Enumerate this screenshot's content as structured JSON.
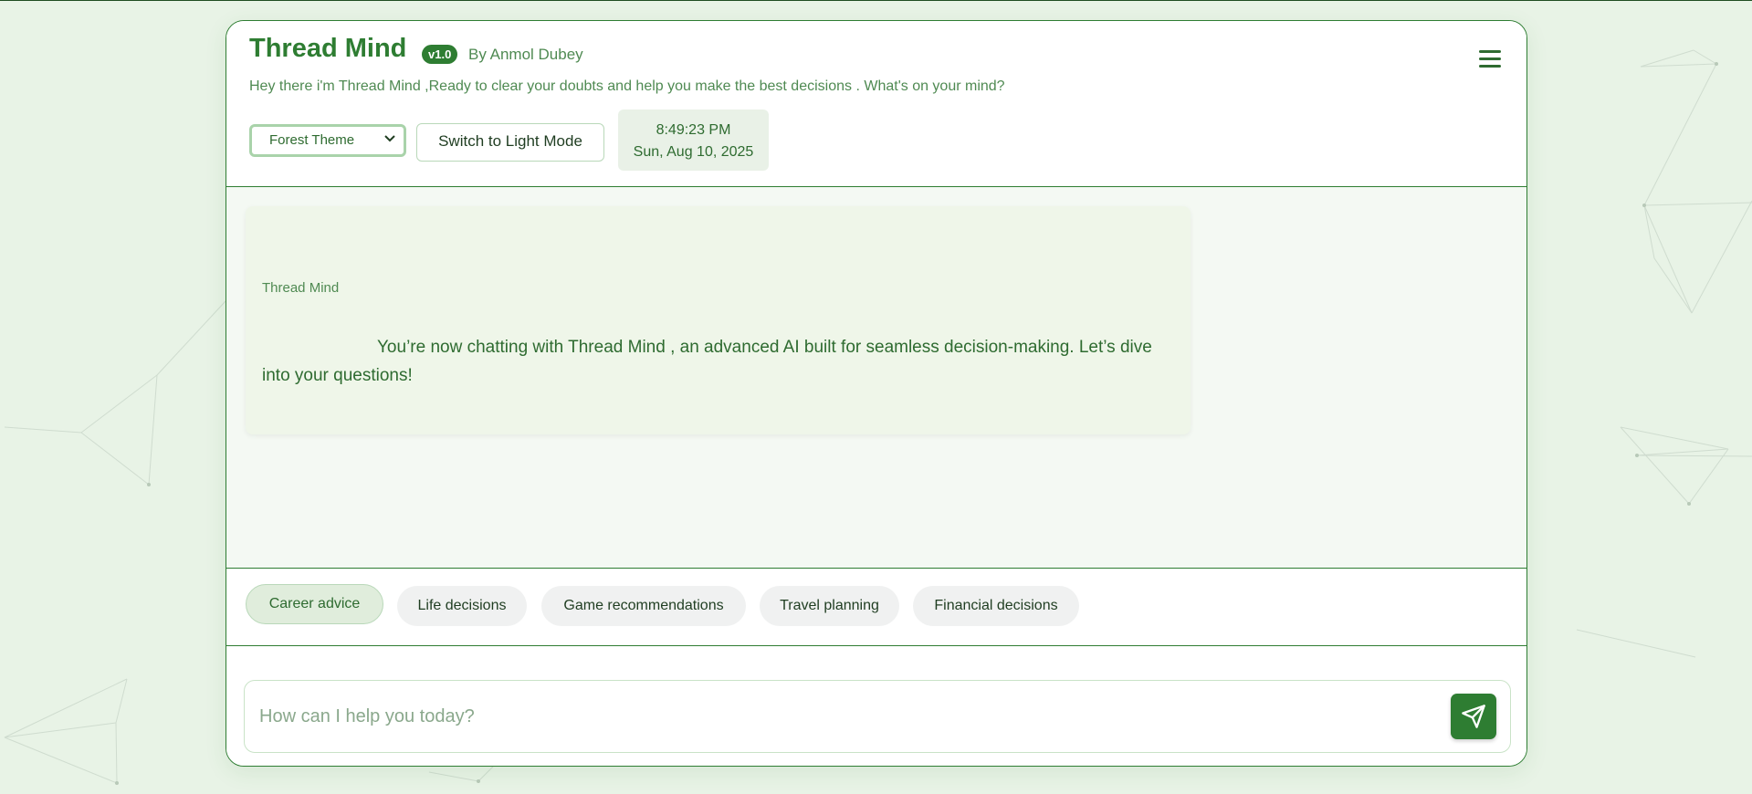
{
  "header": {
    "title": "Thread Mind",
    "version": "v1.0",
    "byline": "By Anmol Dubey",
    "tagline": "Hey there i'm Thread Mind ,Ready to clear your doubts and help you make the best decisions . What's on your mind?",
    "theme_select_value": "Forest Theme",
    "mode_button_label": "Switch to Light Mode",
    "clock_time": "8:49:23 PM",
    "clock_date": "Sun, Aug 10, 2025",
    "menu_icon": "hamburger-menu-icon"
  },
  "chat": {
    "messages": [
      {
        "sender": "Thread Mind",
        "text": "You’re now chatting with Thread Mind , an advanced AI built for seamless decision-making. Let’s dive into your questions!"
      }
    ]
  },
  "suggestions": [
    "Career advice",
    "Life decisions",
    "Game recommendations",
    "Travel planning",
    "Financial decisions"
  ],
  "composer": {
    "placeholder": "How can I help you today?",
    "send_icon": "send-icon"
  },
  "colors": {
    "accent": "#2e7d32",
    "background": "#e8f3e6",
    "bubble": "#eff6e9"
  }
}
